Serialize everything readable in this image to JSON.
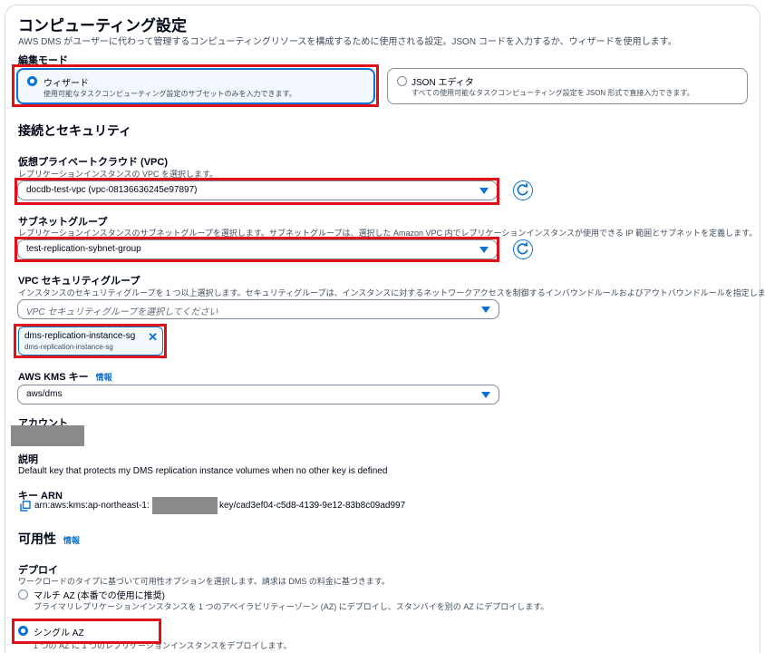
{
  "compute": {
    "title": "コンピューティング設定",
    "description": "AWS DMS がユーザーに代わって管理するコンピューティングリソースを構成するために使用される設定。JSON コードを入力するか、ウィザードを使用します。",
    "edit_mode_label": "編集モード",
    "wizard": {
      "title": "ウィザード",
      "desc": "使用可能なタスクコンピューティング設定のサブセットのみを入力できます。"
    },
    "json": {
      "title": "JSON エディタ",
      "desc": "すべての使用可能なタスクコンピューティング設定を JSON 形式で直接入力できます。"
    }
  },
  "security": {
    "title": "接続とセキュリティ",
    "vpc": {
      "label": "仮想プライベートクラウド (VPC)",
      "desc": "レプリケーションインスタンスの VPC を選択します。",
      "value": "docdb-test-vpc (vpc-08136636245e97897)"
    },
    "subnet": {
      "label": "サブネットグループ",
      "desc": "レプリケーションインスタンスのサブネットグループを選択します。サブネットグループは、選択した Amazon VPC 内でレプリケーションインスタンスが使用できる IP 範囲とサブネットを定義します。",
      "value": "test-replication-sybnet-group"
    },
    "sg": {
      "label": "VPC セキュリティグループ",
      "desc": "インスタンスのセキュリティグループを 1 つ以上選択します。セキュリティグループは、インスタンスに対するネットワークアクセスを制御するインバウンドルールおよびアウトバウンドルールを指定します。",
      "placeholder": "VPC セキュリティグループを選択してください",
      "token_name": "dms-replication-instance-sg",
      "token_sub": "dms-replication-instance-sg"
    },
    "kms": {
      "label": "AWS KMS キー",
      "info": "情報",
      "value": "aws/dms"
    },
    "account_label": "アカウント",
    "explain_label": "説明",
    "explain_text": "Default key that protects my DMS replication instance volumes when no other key is defined",
    "arn_label": "キー ARN",
    "arn_prefix": "arn:aws:kms:ap-northeast-1:",
    "arn_suffix": "key/cad3ef04-c5d8-4139-9e12-83b8c09ad997"
  },
  "availability": {
    "title": "可用性",
    "info": "情報",
    "deploy_label": "デプロイ",
    "deploy_desc": "ワークロードのタイプに基づいて可用性オプションを選択します。請求は DMS の料金に基づきます。",
    "multi_az": {
      "title": "マルチ AZ (本番での使用に推奨)",
      "desc": "プライマリレプリケーションインスタンスを 1 つのアベイラビリティーゾーン (AZ) にデプロイし、スタンバイを別の AZ にデプロイします。"
    },
    "single_az": {
      "title": "シングル AZ",
      "desc": "1 つの AZ に 1 つのレプリケーションインスタンスをデプロイします。"
    }
  },
  "colors": {
    "accent": "#0972d3",
    "highlight": "#e01019",
    "redaction": "#8a8a8a"
  }
}
